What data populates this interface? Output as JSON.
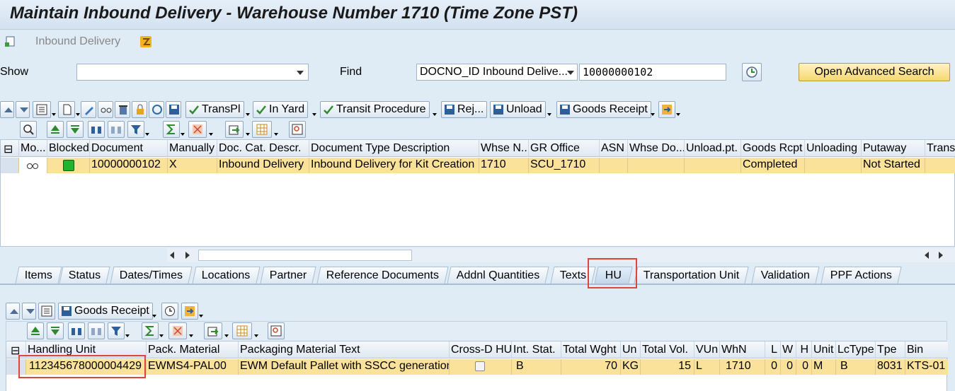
{
  "window": {
    "title": "Maintain Inbound Delivery - Warehouse Number 1710 (Time Zone PST)"
  },
  "menu": {
    "inbound_delivery": "Inbound Delivery"
  },
  "search": {
    "show_label": "Show",
    "show_value": "",
    "find_label": "Find",
    "find_field": "DOCNO_ID Inbound Delive...",
    "find_value": "10000000102",
    "advanced_label": "Open Advanced Search"
  },
  "toolbar1": {
    "transpl": "TransPl",
    "in_yard": "In Yard",
    "transit": "Transit Procedure",
    "rej": "Rej...",
    "unload": "Unload",
    "goods_receipt": "Goods Receipt"
  },
  "top_grid": {
    "columns": [
      "Mo...",
      "Blocked",
      "Document",
      "Manually",
      "Doc. Cat. Descr.",
      "Document Type Description",
      "Whse N...",
      "GR Office",
      "ASN",
      "Whse Do...",
      "Unload.pt.",
      "Goods Rcpt",
      "Unloading",
      "Putaway",
      "Trans"
    ],
    "rows": [
      {
        "document": "10000000102",
        "manually": "X",
        "doc_cat": "Inbound Delivery",
        "doc_type": "Inbound Delivery for Kit Creation",
        "whse": "1710",
        "gr_office": "SCU_1710",
        "asn": "",
        "whse_do": "",
        "unload_pt": "",
        "goods_rcpt": "Completed",
        "unloading": "",
        "putaway": "Not Started",
        "trans": ""
      }
    ]
  },
  "tabs": [
    "Items",
    "Status",
    "Dates/Times",
    "Locations",
    "Partner",
    "Reference Documents",
    "Addnl Quantities",
    "Texts",
    "HU",
    "Transportation Unit",
    "Validation",
    "PPF Actions"
  ],
  "toolbar_hu": {
    "goods_receipt": "Goods Receipt"
  },
  "hu_grid": {
    "columns": [
      "Handling Unit",
      "Pack. Material",
      "Packaging Material Text",
      "Cross-D HU",
      "Int. Stat.",
      "Total Wght",
      "Un",
      "Total Vol.",
      "VUn",
      "WhN",
      "L",
      "W",
      "H",
      "Unit",
      "LcType",
      "Tpe",
      "Bin"
    ],
    "rows": [
      {
        "hu": "112345678000004429",
        "pack_mat": "EWMS4-PAL00",
        "pack_text": "EWM Default Pallet with SSCC generation",
        "int_stat": "B",
        "total_wght": "70",
        "un": "KG",
        "total_vol": "15",
        "vun": "L",
        "whn": "1710",
        "l": "0",
        "w": "0",
        "h": "0",
        "unit": "M",
        "lctype": "B",
        "tpe": "8031",
        "bin": "KTS-01"
      }
    ]
  },
  "colors": {
    "accent_highlight": "#e0453c",
    "row_selected": "#fbe29b",
    "status_green": "#22b52c"
  }
}
